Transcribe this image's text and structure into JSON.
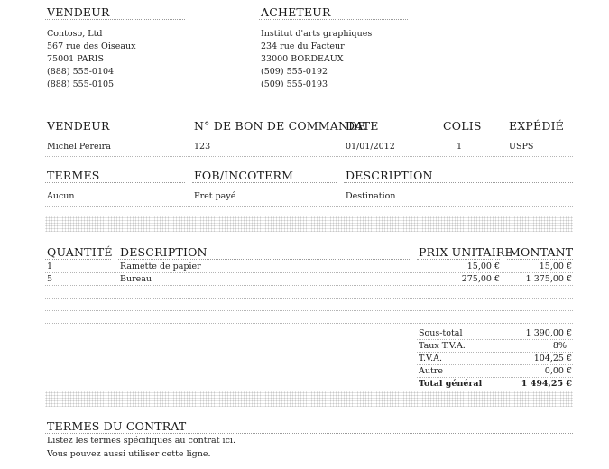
{
  "seller_block": {
    "heading": "VENDEUR",
    "lines": [
      "Contoso, Ltd",
      "567 rue des Oiseaux",
      "75001 PARIS",
      "(888) 555-0104",
      "(888) 555-0105"
    ]
  },
  "buyer_block": {
    "heading": "ACHETEUR",
    "lines": [
      "Institut d'arts graphiques",
      "234 rue du Facteur",
      "33000 BORDEAUX",
      "(509) 555-0192",
      "(509) 555-0193"
    ]
  },
  "order_info": {
    "headers": [
      "VENDEUR",
      "N° DE BON DE COMMANDE",
      "DATE",
      "COLIS",
      "EXPÉDIÉ"
    ],
    "values": [
      "Michel Pereira",
      "123",
      "01/01/2012",
      "1",
      "USPS"
    ]
  },
  "terms_info": {
    "headers": [
      "TERMES",
      "FOB/INCOTERM",
      "DESCRIPTION"
    ],
    "values": [
      "Aucun",
      "Fret payé",
      "Destination"
    ]
  },
  "items_table": {
    "headers": [
      "QUANTITÉ",
      "DESCRIPTION",
      "PRIX UNITAIRE",
      "MONTANT"
    ],
    "rows": [
      [
        "1",
        "Ramette de papier",
        "15,00 €",
        "15,00 €"
      ],
      [
        "5",
        "Bureau",
        "275,00 €",
        "1 375,00 €"
      ]
    ]
  },
  "totals": {
    "rows": [
      {
        "label": "Sous-total",
        "value": "1 390,00 €"
      },
      {
        "label": "Taux T.V.A.",
        "value": "8%"
      },
      {
        "label": "T.V.A.",
        "value": "104,25 €"
      },
      {
        "label": "Autre",
        "value": "0,00 €"
      },
      {
        "label": "Total général",
        "value": "1 494,25 €"
      }
    ]
  },
  "contract": {
    "heading": "TERMES DU CONTRAT",
    "lines": [
      "Listez les termes spécifiques au contrat ici.",
      "Vous pouvez aussi utiliser cette ligne."
    ]
  }
}
